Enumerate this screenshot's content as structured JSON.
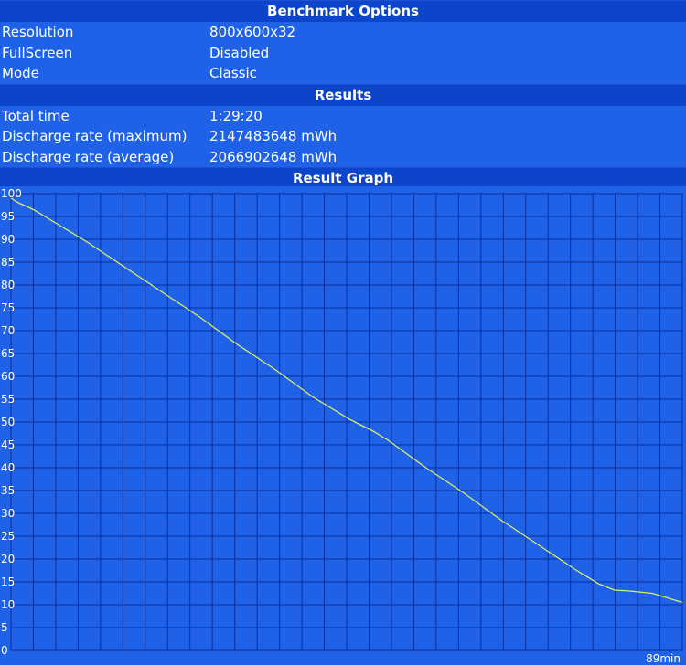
{
  "benchmark_options": {
    "title": "Benchmark Options",
    "rows": [
      {
        "label": "Resolution",
        "value": "800x600x32"
      },
      {
        "label": "FullScreen",
        "value": "Disabled"
      },
      {
        "label": "Mode",
        "value": "Classic"
      }
    ]
  },
  "results": {
    "title": "Results",
    "rows": [
      {
        "label": "Total time",
        "value": "1:29:20"
      },
      {
        "label": "Discharge rate (maximum)",
        "value": "2147483648 mWh"
      },
      {
        "label": "Discharge rate (average)",
        "value": "2066902648 mWh"
      }
    ]
  },
  "result_graph": {
    "title": "Result Graph"
  },
  "colors": {
    "background": "#1f62e8",
    "header": "#0c45c9",
    "grid": "#0a2f9e",
    "line": "#d8ee6a",
    "text": "#ffffff"
  },
  "chart_data": {
    "type": "line",
    "ylim": [
      0,
      100
    ],
    "xlim": [
      0,
      89
    ],
    "y_ticks": [
      0,
      5,
      10,
      15,
      20,
      25,
      30,
      35,
      40,
      45,
      50,
      55,
      60,
      65,
      70,
      75,
      80,
      85,
      90,
      95,
      100
    ],
    "x_end_label": "89min",
    "grid": true,
    "series": [
      {
        "values_x": [
          0,
          1,
          3,
          5,
          10,
          15,
          20,
          25,
          30,
          35,
          40,
          45,
          48,
          50,
          55,
          60,
          65,
          70,
          75,
          78,
          80,
          82,
          85,
          87,
          88,
          89
        ],
        "values_y": [
          99,
          98,
          96.5,
          94.5,
          89.5,
          84,
          78.5,
          73,
          67,
          61.5,
          55.5,
          50.5,
          48,
          46,
          40,
          34.5,
          28.5,
          23,
          17.5,
          14.5,
          13.2,
          13,
          12.5,
          11.5,
          11,
          10.5
        ]
      }
    ]
  }
}
